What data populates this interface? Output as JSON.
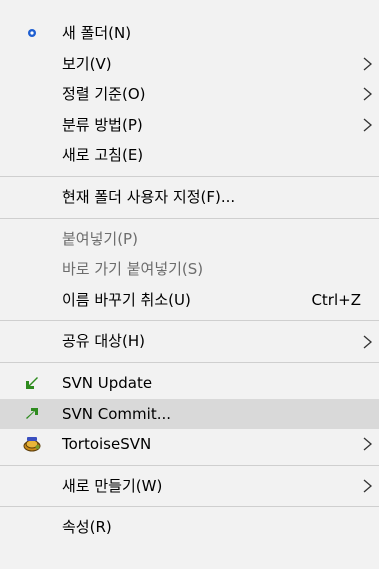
{
  "menu": {
    "items": [
      {
        "label": "새 폴더(N)",
        "icon": "new-folder-dot-icon"
      },
      {
        "label": "보기(V)",
        "submenu": true
      },
      {
        "label": "정렬 기준(O)",
        "submenu": true
      },
      {
        "label": "분류 방법(P)",
        "submenu": true
      },
      {
        "label": "새로 고침(E)"
      },
      {
        "label": "현재 폴더 사용자 지정(F)..."
      },
      {
        "label": "붙여넣기(P)",
        "disabled": true
      },
      {
        "label": "바로 가기 붙여넣기(S)",
        "disabled": true
      },
      {
        "label": "이름 바꾸기 취소(U)",
        "shortcut": "Ctrl+Z"
      },
      {
        "label": "공유 대상(H)",
        "submenu": true
      },
      {
        "label": "SVN Update",
        "icon": "svn-update-icon"
      },
      {
        "label": "SVN Commit...",
        "icon": "svn-commit-icon",
        "highlighted": true
      },
      {
        "label": "TortoiseSVN",
        "icon": "tortoisesvn-icon",
        "submenu": true
      },
      {
        "label": "새로 만들기(W)",
        "submenu": true
      },
      {
        "label": "속성(R)"
      }
    ]
  },
  "colors": {
    "background": "#f2f2f2",
    "hover": "#d9d9d9",
    "disabled_text": "#6d6d6d",
    "separator": "#cfcfcf",
    "svn_green": "#2e8b1f",
    "dot_blue": "#1f5fd1"
  }
}
